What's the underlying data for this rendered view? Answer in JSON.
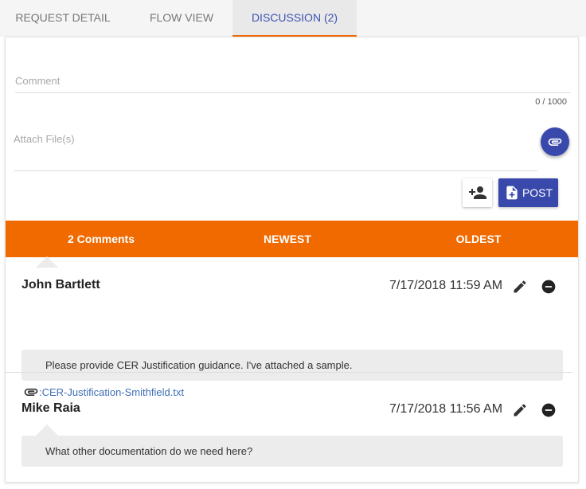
{
  "tabs": [
    {
      "label": "REQUEST DETAIL"
    },
    {
      "label": "FLOW VIEW"
    },
    {
      "label": "DISCUSSION (2)"
    }
  ],
  "composer": {
    "comment_placeholder": "Comment",
    "char_count": "0 / 1000",
    "attach_label": "Attach File(s)",
    "post_label": "POST"
  },
  "sortbar": {
    "count_label": "2 Comments",
    "newest_label": "NEWEST",
    "oldest_label": "OLDEST"
  },
  "comments": [
    {
      "author": "John Bartlett",
      "timestamp": "7/17/2018 11:59 AM",
      "text": "Please provide CER Justification guidance. I've attached a sample.",
      "attachment": ":CER-Justification-Smithfield.txt"
    },
    {
      "author": "Mike Raia",
      "timestamp": "7/17/2018 11:56 AM",
      "text": "What other documentation do we need here?"
    }
  ],
  "colors": {
    "accent": "#f06a00",
    "primary": "#3949ab",
    "link": "#3f6fb8"
  },
  "icons": [
    "paperclip-icon",
    "person-add-icon",
    "note-add-icon",
    "pencil-icon",
    "remove-circle-icon"
  ]
}
